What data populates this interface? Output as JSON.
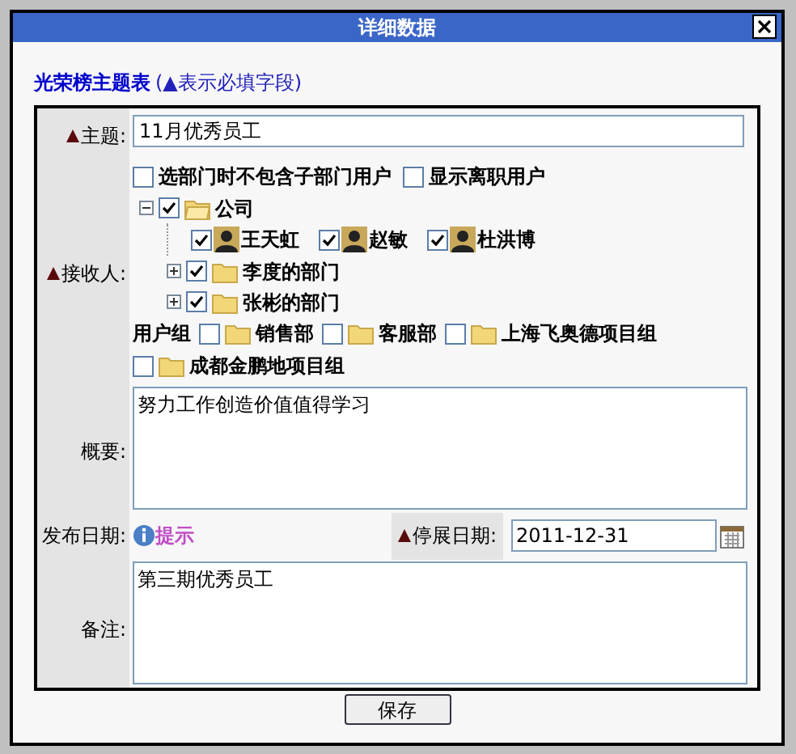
{
  "window": {
    "title": "详细数据"
  },
  "form_header": {
    "title": "光荣榜主题表",
    "hint": "(▲表示必填字段)"
  },
  "subject": {
    "label": "主题:",
    "required": true,
    "value": "11月优秀员工"
  },
  "recipients": {
    "label": "接收人:",
    "required": true,
    "options": [
      {
        "label": "选部门时不包含子部门用户",
        "checked": false
      },
      {
        "label": "显示离职用户",
        "checked": false
      }
    ],
    "tree": [
      {
        "kind": "folder",
        "label": "公司",
        "checked": true,
        "expanded": true,
        "children": [
          {
            "kind": "user",
            "label": "王天虹",
            "checked": true
          },
          {
            "kind": "user",
            "label": "赵敏",
            "checked": true
          },
          {
            "kind": "user",
            "label": "杜洪博",
            "checked": true
          },
          {
            "kind": "folder",
            "label": "李度的部门",
            "checked": true,
            "expanded": false
          },
          {
            "kind": "folder",
            "label": "张彬的部门",
            "checked": true,
            "expanded": false
          }
        ]
      }
    ],
    "groups": {
      "label": "用户组",
      "items": [
        {
          "label": "销售部",
          "checked": false
        },
        {
          "label": "客服部",
          "checked": false
        },
        {
          "label": "上海飞奥德项目组",
          "checked": false
        },
        {
          "label": "成都金鹏地项目组",
          "checked": false
        }
      ]
    }
  },
  "summary": {
    "label": "概要:",
    "value": "努力工作创造价值值得学习"
  },
  "publish_date": {
    "label": "发布日期:",
    "hint": "提示"
  },
  "end_date": {
    "label": "停展日期:",
    "required": true,
    "value": "2011-12-31"
  },
  "remarks": {
    "label": "备注:",
    "value": "第三期优秀员工"
  },
  "buttons": [
    {
      "label": "保存"
    }
  ]
}
